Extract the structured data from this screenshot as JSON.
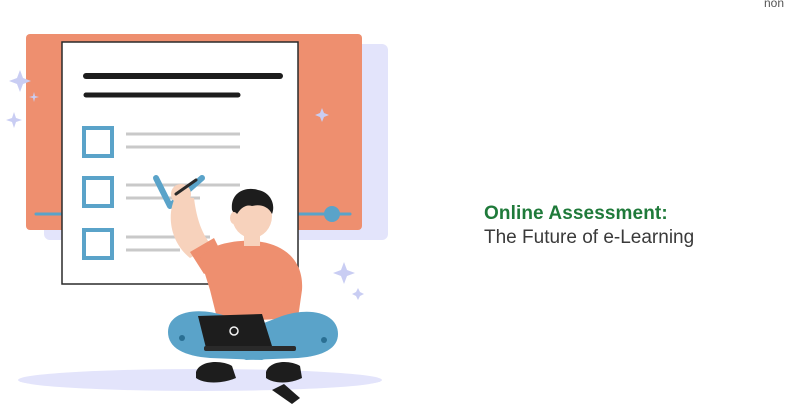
{
  "corner_text": "non",
  "headline": {
    "title": "Online Assessment:",
    "subtitle": "The Future of e-Learning"
  },
  "colors": {
    "brand_green": "#1f7a3a",
    "accent_salmon": "#ee8f6f",
    "lavender": "#e3e4fb",
    "checkbox_blue": "#5aa3c9",
    "text_dark": "#3a3a3a"
  },
  "illustration": {
    "subject": "person-with-laptop-checklist",
    "icons": [
      "checklist-icon",
      "checkbox-icon",
      "checkmark-icon",
      "laptop-icon",
      "sparkle-icon"
    ]
  }
}
